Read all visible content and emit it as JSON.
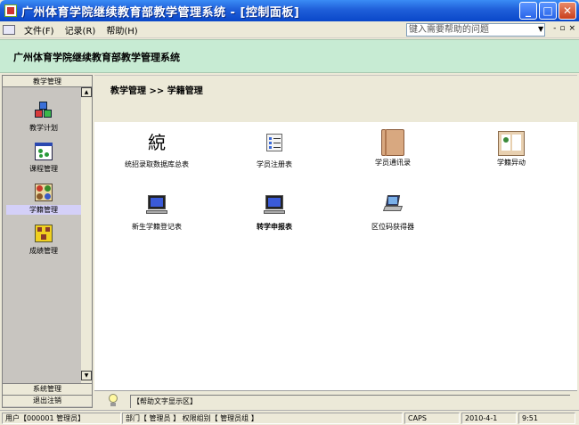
{
  "window": {
    "title": "广州体育学院继续教育部教学管理系统 - [控制面板]",
    "min_glyph": "_",
    "max_glyph": "□",
    "close_glyph": "✕"
  },
  "menu": {
    "items": [
      "文件(F)",
      "记录(R)",
      "帮助(H)"
    ],
    "help_placeholder": "键入需要帮助的问题",
    "mdi_buttons": [
      "- ",
      "▫",
      "×"
    ]
  },
  "header": {
    "title": "广州体育学院继续教育部教学管理系统"
  },
  "nav": {
    "heading": "教学管理",
    "items": [
      {
        "label": "教学计划",
        "icon": "cubes-icon"
      },
      {
        "label": "课程管理",
        "icon": "dots-window-icon"
      },
      {
        "label": "学籍管理",
        "icon": "puzzle-icon",
        "selected": true
      },
      {
        "label": "成绩管理",
        "icon": "grid-blocks-icon"
      }
    ],
    "scroll_up": "▲",
    "scroll_down": "▼",
    "bottom": [
      "系统管理",
      "退出注销"
    ]
  },
  "content": {
    "breadcrumb": "教学管理 >> 学籍管理",
    "tiles": [
      {
        "label": "统招录取数据库总表",
        "icon": "calligraphy-icon"
      },
      {
        "label": "学员注册表",
        "icon": "checklist-icon"
      },
      {
        "label": "学员通讯录",
        "icon": "book-icon"
      },
      {
        "label": "学籍异动",
        "icon": "open-book-icon"
      },
      {
        "label": "新生学籍登记表",
        "icon": "monitor-icon"
      },
      {
        "label": "转学申报表",
        "icon": "monitor-icon"
      },
      {
        "label": "区位码获得器",
        "icon": "laptop-icon"
      }
    ]
  },
  "helpband": {
    "text": "【帮助文字显示区】"
  },
  "status": {
    "user": "用户【000001 管理员】",
    "dept": "部门【 管理员 】 权限组别【 管理员组 】",
    "server": "CAPS",
    "date": "2010-4-1",
    "time": "9:51"
  }
}
